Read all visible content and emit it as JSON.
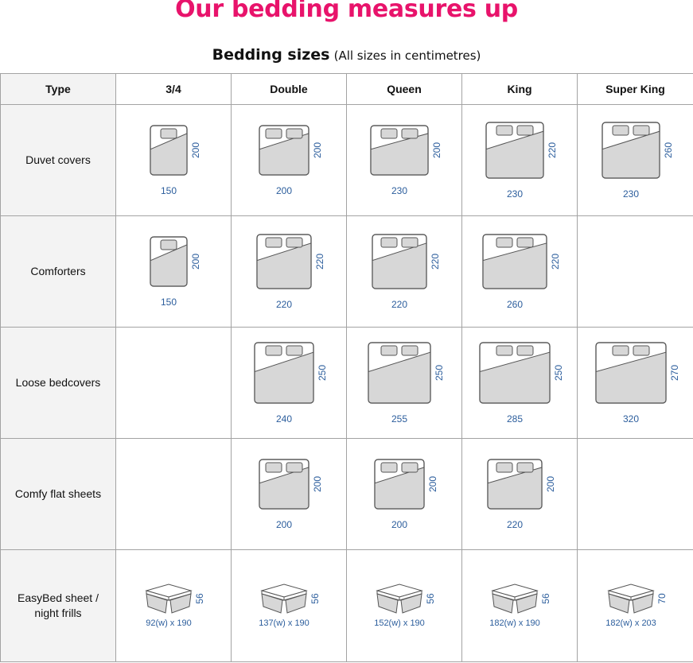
{
  "headline": "Our bedding measures up",
  "table_title": "Bedding sizes",
  "table_note": "(All sizes in centimetres)",
  "columns": [
    "Type",
    "3/4",
    "Double",
    "Queen",
    "King",
    "Super King"
  ],
  "colors": {
    "headline": "#e8136b",
    "dimension_text": "#2b5d9c",
    "icon_fill": "#d7d7d7",
    "icon_stroke": "#555555",
    "label_column_bg": "#f3f3f3"
  },
  "rows": [
    {
      "label": "Duvet covers",
      "icon": "bed-icon",
      "cells": [
        {
          "width": "150",
          "length": "200"
        },
        {
          "width": "200",
          "length": "200"
        },
        {
          "width": "230",
          "length": "200"
        },
        {
          "width": "230",
          "length": "220"
        },
        {
          "width": "230",
          "length": "260"
        }
      ]
    },
    {
      "label": "Comforters",
      "icon": "bed-icon",
      "cells": [
        {
          "width": "150",
          "length": "200"
        },
        {
          "width": "220",
          "length": "220"
        },
        {
          "width": "220",
          "length": "220"
        },
        {
          "width": "260",
          "length": "220"
        },
        null
      ]
    },
    {
      "label": "Loose bedcovers",
      "icon": "bed-icon",
      "cells": [
        null,
        {
          "width": "240",
          "length": "250"
        },
        {
          "width": "255",
          "length": "250"
        },
        {
          "width": "285",
          "length": "250"
        },
        {
          "width": "320",
          "length": "270"
        }
      ]
    },
    {
      "label": "Comfy flat sheets",
      "icon": "bed-icon",
      "cells": [
        null,
        {
          "width": "200",
          "length": "200"
        },
        {
          "width": "200",
          "length": "200"
        },
        {
          "width": "220",
          "length": "200"
        },
        null
      ]
    },
    {
      "label": "EasyBed sheet / night frills",
      "icon": "box-bed-icon",
      "cells": [
        {
          "width": "92(w) x 190",
          "length": "56"
        },
        {
          "width": "137(w) x 190",
          "length": "56"
        },
        {
          "width": "152(w) x 190",
          "length": "56"
        },
        {
          "width": "182(w) x 190",
          "length": "56"
        },
        {
          "width": "182(w) x 203",
          "length": "70"
        }
      ]
    }
  ]
}
